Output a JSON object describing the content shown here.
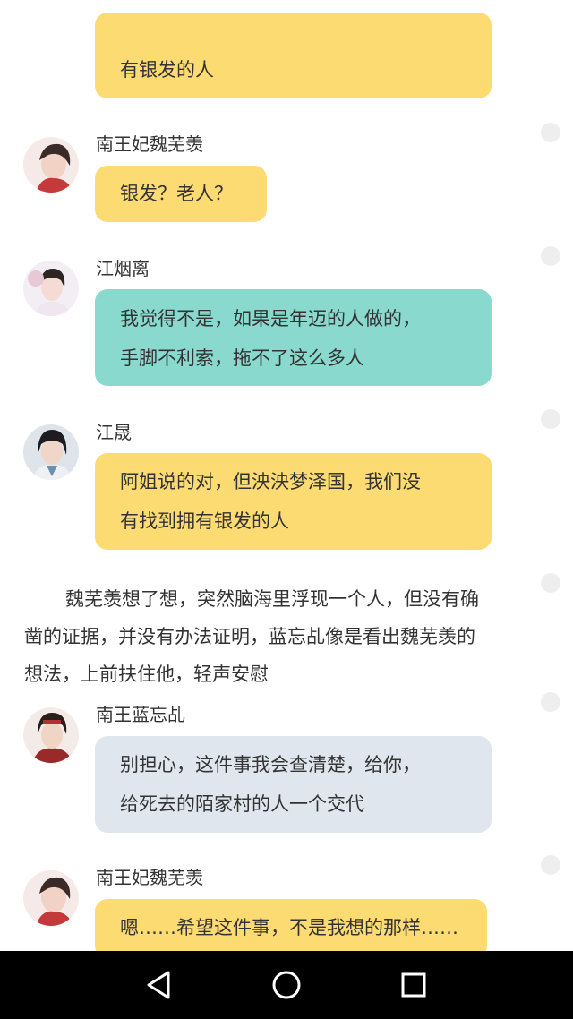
{
  "messages": [
    {
      "sender": "",
      "style": "yellow",
      "lines": [
        "",
        "有银发的人"
      ]
    },
    {
      "sender": "南王妃魏芜羡",
      "style": "yellow",
      "lines": [
        "银发？老人？"
      ]
    },
    {
      "sender": "江烟离",
      "style": "teal",
      "lines": [
        "我觉得不是，如果是年迈的人做的，",
        "手脚不利索，拖不了这么多人"
      ]
    },
    {
      "sender": "江晟",
      "style": "yellow",
      "lines": [
        "阿姐说的对，但泱泱梦泽国，我们没",
        "有找到拥有银发的人"
      ]
    },
    {
      "sender": "南王蓝忘乩",
      "style": "gray",
      "lines": [
        "别担心，这件事我会查清楚，给你，",
        "给死去的陌家村的人一个交代"
      ]
    },
    {
      "sender": "南王妃魏芜羡",
      "style": "yellow",
      "lines": [
        "嗯……希望这件事，不是我想的那样……"
      ]
    }
  ],
  "narration": {
    "lines": [
      "魏芜羡想了想，突然脑海里浮现一个人，但没有确",
      "凿的证据，并没有办法证明，蓝忘乩像是看出魏芜羡的",
      "想法，上前扶住他，轻声安慰"
    ]
  },
  "colors": {
    "yellow_bubble": "#fcdb72",
    "teal_bubble": "#8ad9cf",
    "gray_bubble": "#e0e6ee",
    "nav_bar": "#000000"
  },
  "navbar": {
    "back_icon": "triangle-back-icon",
    "home_icon": "circle-home-icon",
    "recents_icon": "square-recents-icon"
  }
}
